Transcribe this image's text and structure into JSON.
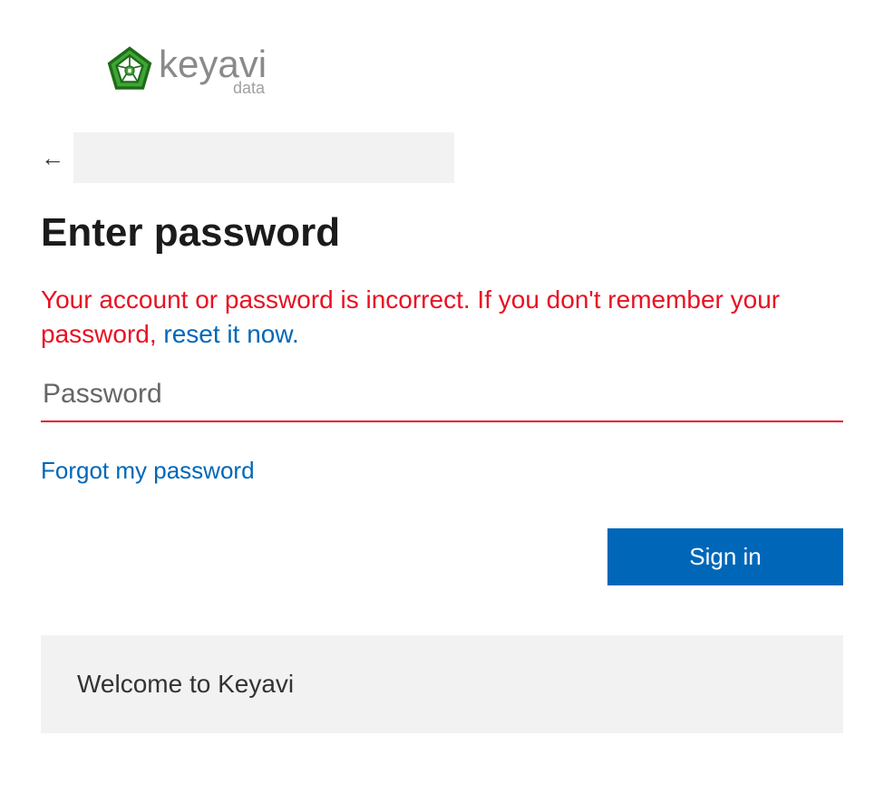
{
  "logo": {
    "brand_part1": "key",
    "brand_part2": "avi",
    "subtext": "data"
  },
  "heading": "Enter password",
  "error": {
    "text_prefix": "Your account or password is incorrect. If you don't remember your password, ",
    "reset_link": "reset it now."
  },
  "password_field": {
    "placeholder": "Password",
    "value": ""
  },
  "links": {
    "forgot_password": "Forgot my password"
  },
  "buttons": {
    "signin": "Sign in"
  },
  "banner": {
    "welcome": "Welcome to Keyavi"
  },
  "colors": {
    "error": "#e81123",
    "link": "#0067b8",
    "primary_button": "#0067b8"
  }
}
